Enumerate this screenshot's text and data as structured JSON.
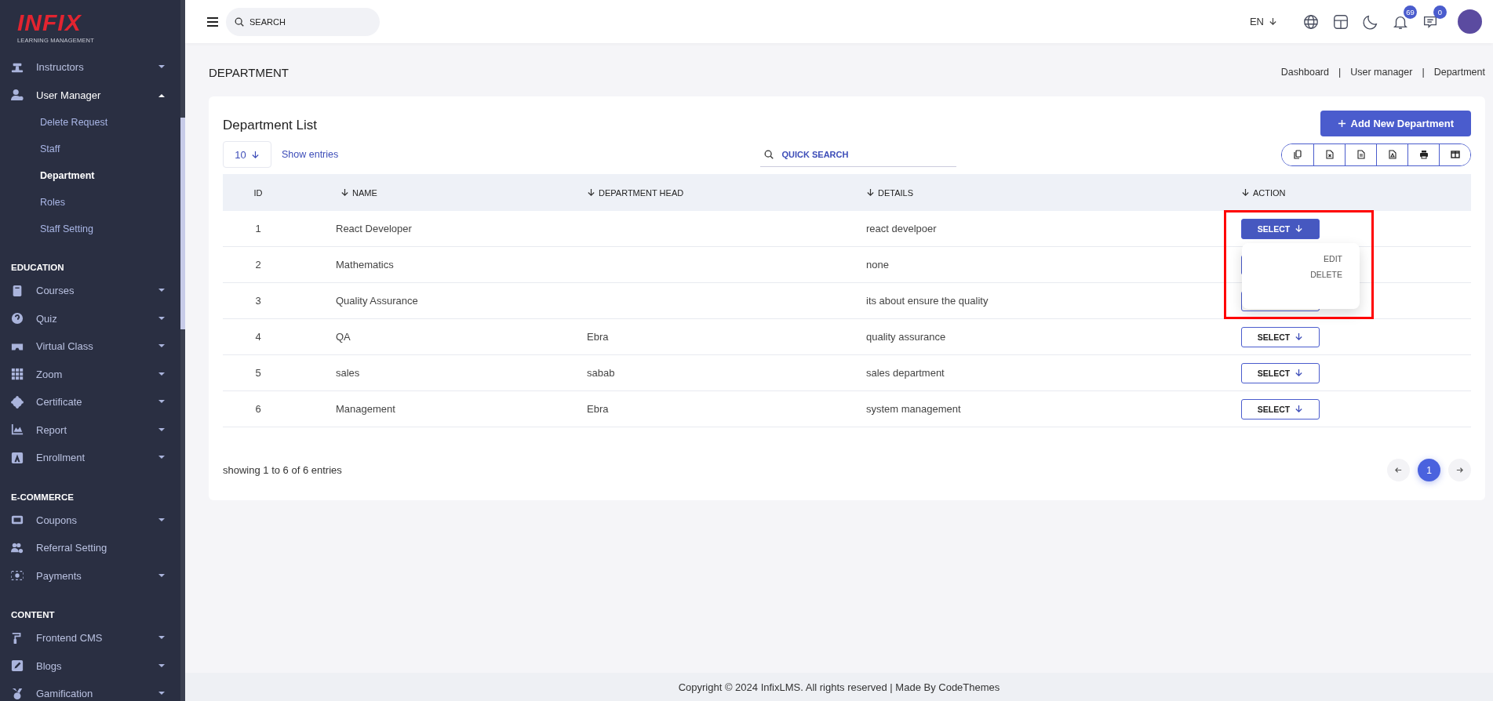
{
  "sidebar": {
    "logo": {
      "brand": "INFIX",
      "tagline": "LEARNING MANAGEMENT"
    },
    "sections": [
      {
        "items": [
          {
            "label": "Instructors",
            "kind": "dropdown",
            "expanded": false,
            "selected": false
          },
          {
            "label": "User Manager",
            "kind": "dropdown",
            "expanded": true,
            "selected": true,
            "children": [
              {
                "label": "Delete Request",
                "selected": false
              },
              {
                "label": "Staff",
                "selected": false
              },
              {
                "label": "Department",
                "selected": true
              },
              {
                "label": "Roles",
                "selected": false
              },
              {
                "label": "Staff Setting",
                "selected": false
              }
            ]
          }
        ]
      },
      {
        "heading": "EDUCATION",
        "items": [
          {
            "label": "Courses",
            "kind": "dropdown",
            "expanded": false,
            "selected": false
          },
          {
            "label": "Quiz",
            "kind": "dropdown",
            "expanded": false,
            "selected": false
          },
          {
            "label": "Virtual Class",
            "kind": "dropdown",
            "expanded": false,
            "selected": false
          },
          {
            "label": "Zoom",
            "kind": "dropdown",
            "expanded": false,
            "selected": false
          },
          {
            "label": "Certificate",
            "kind": "dropdown",
            "expanded": false,
            "selected": false
          },
          {
            "label": "Report",
            "kind": "dropdown",
            "expanded": false,
            "selected": false
          },
          {
            "label": "Enrollment",
            "kind": "dropdown",
            "expanded": false,
            "selected": false
          }
        ]
      },
      {
        "heading": "E-COMMERCE",
        "items": [
          {
            "label": "Coupons",
            "kind": "dropdown",
            "expanded": false,
            "selected": false
          },
          {
            "label": "Referral Setting",
            "kind": "link",
            "selected": false
          },
          {
            "label": "Payments",
            "kind": "dropdown",
            "expanded": false,
            "selected": false
          }
        ]
      },
      {
        "heading": "CONTENT",
        "items": [
          {
            "label": "Frontend CMS",
            "kind": "dropdown",
            "expanded": false,
            "selected": false
          },
          {
            "label": "Blogs",
            "kind": "dropdown",
            "expanded": false,
            "selected": false
          },
          {
            "label": "Gamification",
            "kind": "dropdown",
            "expanded": false,
            "selected": false
          }
        ]
      }
    ]
  },
  "topbar": {
    "search": {
      "placeholder": "SEARCH"
    },
    "language": "EN",
    "notifications": "69",
    "messages": "0"
  },
  "page": {
    "title": "DEPARTMENT",
    "breadcrumb": {
      "separator": "|",
      "items": [
        "Dashboard",
        "User manager",
        "Department"
      ]
    }
  },
  "card": {
    "title": "Department List",
    "add_button": "Add New Department",
    "page_size": "10",
    "show_entries": "Show entries",
    "quick_search": {
      "placeholder": "QUICK SEARCH"
    },
    "table": {
      "columns": [
        {
          "label": "ID",
          "sortable": false
        },
        {
          "label": "NAME",
          "sortable": true
        },
        {
          "label": "DEPARTMENT HEAD",
          "sortable": true
        },
        {
          "label": "DETAILS",
          "sortable": true
        },
        {
          "label": "ACTION",
          "sortable": true
        }
      ],
      "rows": [
        {
          "id": "1",
          "name": "React Developer",
          "head": "",
          "details": "react develpoer",
          "action": "SELECT",
          "open": true
        },
        {
          "id": "2",
          "name": "Mathematics",
          "head": "",
          "details": "none",
          "open": false
        },
        {
          "id": "3",
          "name": "Quality Assurance",
          "head": "",
          "details": "its about ensure the quality",
          "open": false
        },
        {
          "id": "4",
          "name": "QA",
          "head": "Ebra",
          "details": "quality assurance",
          "action": "SELECT",
          "open": false
        },
        {
          "id": "5",
          "name": "sales",
          "head": "sabab",
          "details": "sales department",
          "action": "SELECT",
          "open": false
        },
        {
          "id": "6",
          "name": "Management",
          "head": "Ebra",
          "details": "system management",
          "action": "SELECT",
          "open": false
        }
      ],
      "action_menu": [
        "EDIT",
        "DELETE"
      ]
    },
    "summary": "showing 1 to 6 of 6 entries",
    "pages": [
      {
        "label": "1",
        "selected": true
      }
    ]
  },
  "footer": "Copyright © 2024 InfixLMS. All rights reserved | Made By CodeThemes"
}
